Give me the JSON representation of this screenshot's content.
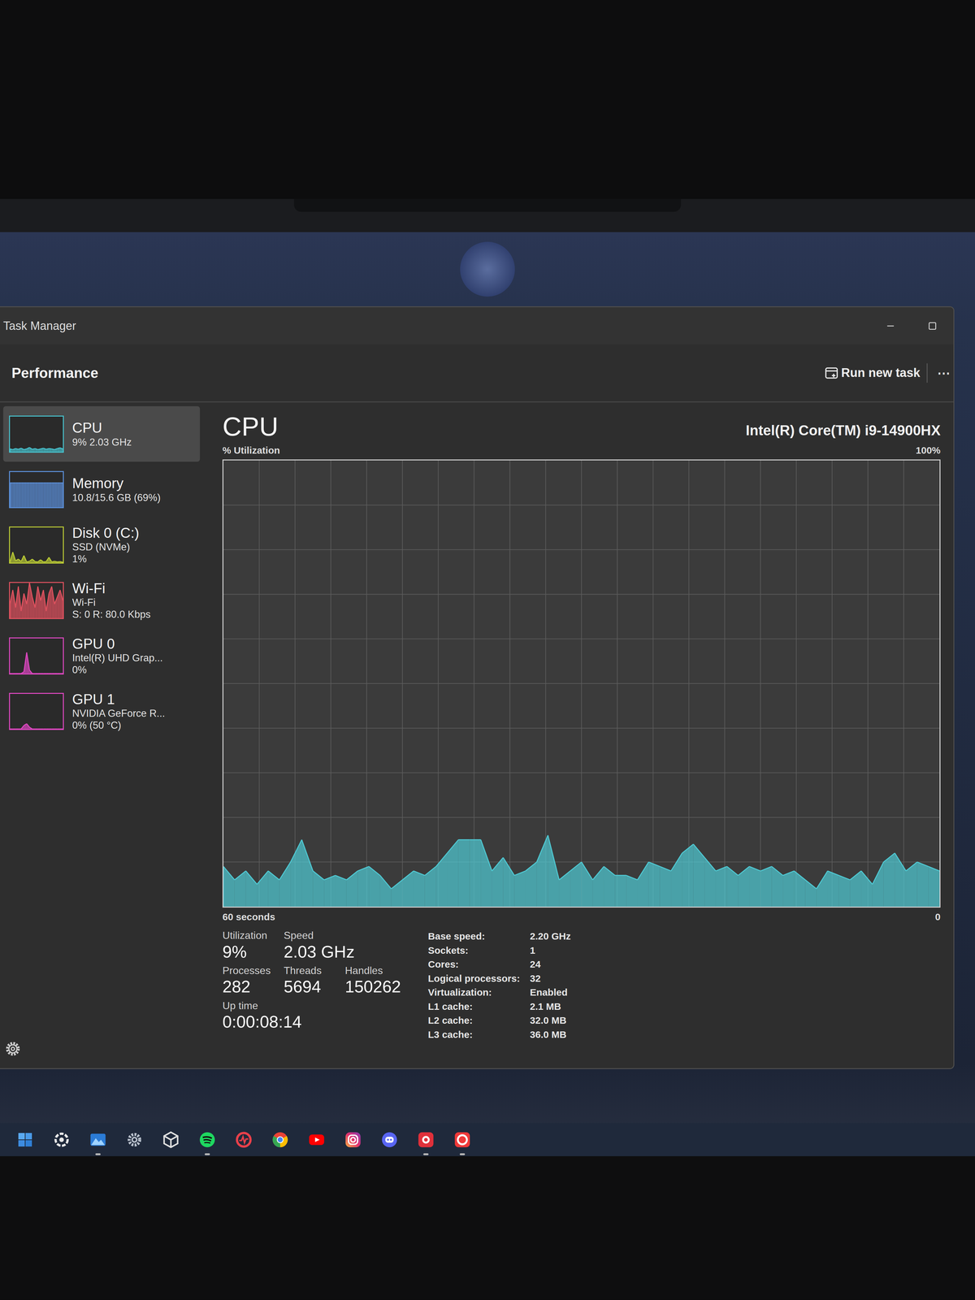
{
  "window": {
    "title": "Task Manager"
  },
  "header": {
    "title": "Performance",
    "run_task": "Run new task",
    "more": "⋯"
  },
  "sidebar": {
    "items": [
      {
        "title": "CPU",
        "lines": [
          "9% 2.03 GHz"
        ],
        "selected": true,
        "color": "#47c1cc",
        "values": [
          8,
          6,
          9,
          7,
          10,
          6,
          8,
          12,
          7,
          9,
          6,
          8,
          10,
          7,
          9,
          8,
          6,
          9,
          11,
          8
        ]
      },
      {
        "title": "Memory",
        "lines": [
          "10.8/15.6 GB (69%)"
        ],
        "selected": false,
        "color": "#5b8fd8",
        "values": [
          69,
          69,
          69,
          69,
          69,
          69,
          69,
          69,
          69,
          69,
          69,
          69,
          69,
          69,
          69,
          69,
          69,
          69,
          69,
          69
        ]
      },
      {
        "title": "Disk 0 (C:)",
        "lines": [
          "SSD (NVMe)",
          "1%"
        ],
        "selected": false,
        "color": "#b9c935",
        "values": [
          2,
          30,
          5,
          10,
          3,
          20,
          2,
          4,
          10,
          3,
          2,
          8,
          2,
          3,
          15,
          2,
          4,
          2,
          3,
          1
        ]
      },
      {
        "title": "Wi-Fi",
        "lines": [
          "Wi-Fi",
          "S: 0 R: 80.0 Kbps"
        ],
        "selected": false,
        "color": "#e0525f",
        "values": [
          40,
          80,
          30,
          90,
          20,
          70,
          40,
          100,
          60,
          30,
          90,
          50,
          80,
          20,
          70,
          90,
          40,
          60,
          80,
          50
        ]
      },
      {
        "title": "GPU 0",
        "lines": [
          "Intel(R) UHD Grap...",
          "0%"
        ],
        "selected": false,
        "color": "#dd47c0",
        "values": [
          0,
          0,
          0,
          0,
          0,
          5,
          60,
          10,
          0,
          0,
          0,
          0,
          0,
          0,
          0,
          0,
          0,
          0,
          0,
          0
        ]
      },
      {
        "title": "GPU 1",
        "lines": [
          "NVIDIA GeForce R...",
          "0% (50 °C)"
        ],
        "selected": false,
        "color": "#dd47c0",
        "values": [
          0,
          0,
          0,
          0,
          0,
          10,
          15,
          5,
          0,
          0,
          0,
          0,
          0,
          0,
          0,
          0,
          0,
          0,
          0,
          0
        ]
      }
    ]
  },
  "cpu": {
    "title": "CPU",
    "model": "Intel(R) Core(TM) i9-14900HX",
    "y_label": "% Utilization",
    "y_max": "100%",
    "x_label": "60 seconds",
    "x_min": "0",
    "values": [
      9,
      6,
      8,
      5,
      8,
      6,
      10,
      15,
      8,
      6,
      7,
      6,
      8,
      9,
      7,
      4,
      6,
      8,
      7,
      9,
      12,
      15,
      15,
      15,
      8,
      11,
      7,
      8,
      10,
      16,
      6,
      8,
      10,
      6,
      9,
      7,
      7,
      6,
      10,
      9,
      8,
      12,
      14,
      11,
      8,
      9,
      7,
      9,
      8,
      9,
      7,
      8,
      6,
      4,
      8,
      7,
      6,
      8,
      5,
      10,
      12,
      8,
      10,
      9,
      8
    ],
    "stat_rows": [
      [
        {
          "label": "Utilization",
          "value": "9%"
        },
        {
          "label": "Speed",
          "value": "2.03 GHz"
        }
      ],
      [
        {
          "label": "Processes",
          "value": "282"
        },
        {
          "label": "Threads",
          "value": "5694"
        },
        {
          "label": "Handles",
          "value": "150262"
        }
      ],
      [
        {
          "label": "Up time",
          "value": "0:00:08:14"
        }
      ]
    ],
    "specs": [
      {
        "label": "Base speed:",
        "value": "2.20 GHz"
      },
      {
        "label": "Sockets:",
        "value": "1"
      },
      {
        "label": "Cores:",
        "value": "24"
      },
      {
        "label": "Logical processors:",
        "value": "32"
      },
      {
        "label": "Virtualization:",
        "value": "Enabled"
      },
      {
        "label": "L1 cache:",
        "value": "2.1 MB"
      },
      {
        "label": "L2 cache:",
        "value": "32.0 MB"
      },
      {
        "label": "L3 cache:",
        "value": "36.0 MB"
      }
    ]
  },
  "taskbar": {
    "items": [
      {
        "kind": "start",
        "running": false
      },
      {
        "kind": "copilot",
        "running": false
      },
      {
        "kind": "photos",
        "running": true
      },
      {
        "kind": "settings",
        "running": false
      },
      {
        "kind": "cube",
        "running": false
      },
      {
        "kind": "spotify",
        "running": true
      },
      {
        "kind": "ring",
        "running": false
      },
      {
        "kind": "chrome",
        "running": false
      },
      {
        "kind": "youtube",
        "running": false
      },
      {
        "kind": "instagram",
        "running": false
      },
      {
        "kind": "discord",
        "running": false
      },
      {
        "kind": "redapp",
        "running": true
      },
      {
        "kind": "vivaldi",
        "running": true
      }
    ]
  }
}
